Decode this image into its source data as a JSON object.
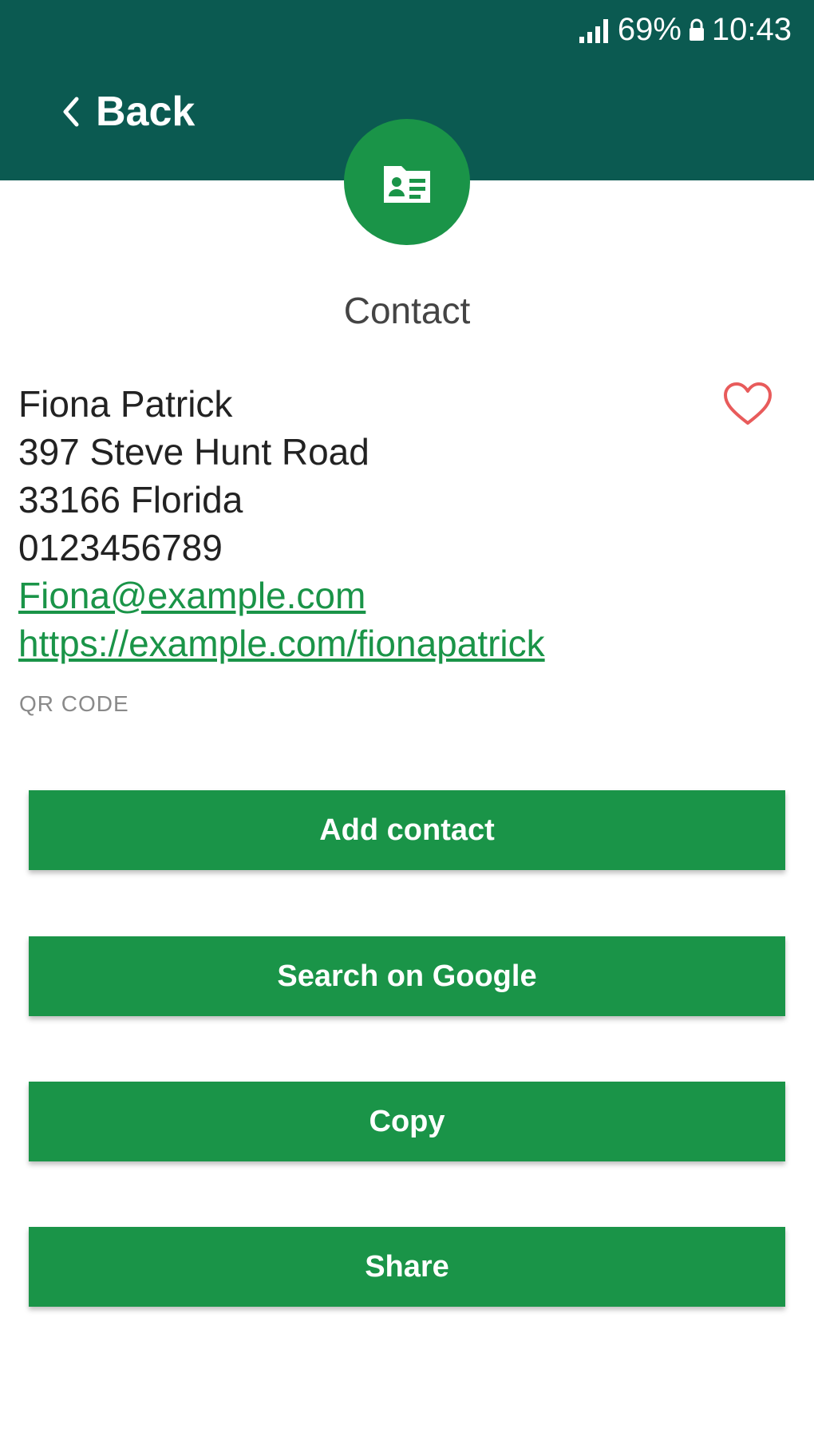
{
  "status_bar": {
    "battery": "69%",
    "time": "10:43"
  },
  "header": {
    "back_label": "Back"
  },
  "title": "Contact",
  "contact": {
    "name": "Fiona Patrick",
    "address_line1": "397 Steve Hunt Road",
    "address_line2": "33166 Florida",
    "phone": "0123456789",
    "email": "Fiona@example.com",
    "url": "https://example.com/fionapatrick"
  },
  "code_type": "QR CODE",
  "actions": {
    "add_contact": "Add contact",
    "search_google": "Search on Google",
    "copy": "Copy",
    "share": "Share"
  },
  "colors": {
    "header_bg": "#0b5a51",
    "accent": "#1a9448",
    "favorite": "#e85b5b"
  },
  "icons": [
    "signal-icon",
    "lock-icon",
    "back-chevron-icon",
    "contact-card-icon",
    "heart-icon"
  ]
}
